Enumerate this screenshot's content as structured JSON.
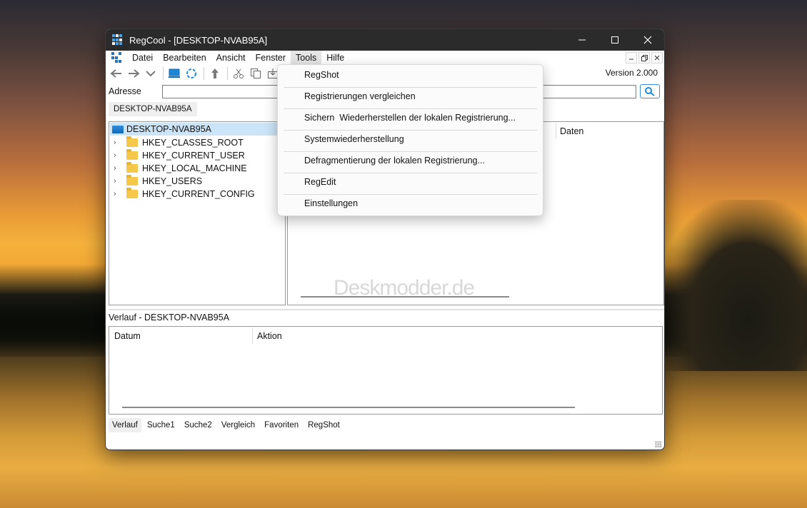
{
  "window": {
    "title": "RegCool - [DESKTOP-NVAB95A]",
    "controls": {
      "minimize": "—",
      "maximize": "☐",
      "close": "✕"
    }
  },
  "menubar": {
    "items": [
      "Datei",
      "Bearbeiten",
      "Ansicht",
      "Fenster",
      "Tools",
      "Hilfe"
    ],
    "active": "Tools",
    "mdi_controls": [
      "–",
      "🗗",
      "✕"
    ]
  },
  "toolbar": {
    "buttons": [
      "back-arrow-icon",
      "forward-arrow-icon",
      "dropdown-chevron-icon",
      "computer-icon",
      "refresh-icon",
      "up-arrow-icon",
      "cut-icon",
      "copy-icon",
      "import-icon"
    ],
    "version": "Version 2.000"
  },
  "address": {
    "label": "Adresse",
    "value": ""
  },
  "doc_tab": {
    "label": "DESKTOP-NVAB95A"
  },
  "tree": {
    "root": "DESKTOP-NVAB95A",
    "nodes": [
      "HKEY_CLASSES_ROOT",
      "HKEY_CURRENT_USER",
      "HKEY_LOCAL_MACHINE",
      "HKEY_USERS",
      "HKEY_CURRENT_CONFIG"
    ]
  },
  "values": {
    "columns": [
      "Daten"
    ]
  },
  "watermark": "Deskmodder.de",
  "history": {
    "title": "Verlauf - DESKTOP-NVAB95A",
    "columns": [
      "Datum",
      "Aktion"
    ]
  },
  "bottom_tabs": {
    "items": [
      "Verlauf",
      "Suche1",
      "Suche2",
      "Vergleich",
      "Favoriten",
      "RegShot"
    ],
    "active": "Verlauf"
  },
  "tools_menu": {
    "items": [
      "RegShot",
      "Registrierungen vergleichen",
      "Sichern  Wiederherstellen der lokalen Registrierung...",
      "Systemwiederherstellung",
      "Defragmentierung der lokalen Registrierung...",
      "RegEdit",
      "Einstellungen"
    ]
  },
  "colors": {
    "accent": "#1e88d8",
    "titlebar": "#2b2b2b",
    "selection": "#cce4f7",
    "folder": "#f5c84a"
  }
}
